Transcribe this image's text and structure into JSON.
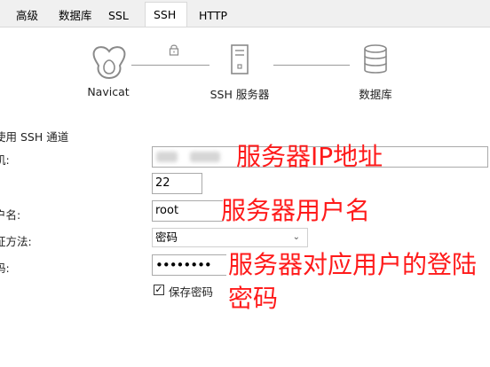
{
  "tabs": [
    {
      "label": "高级"
    },
    {
      "label": "数据库"
    },
    {
      "label": "SSL"
    },
    {
      "label": "SSH",
      "active": true
    },
    {
      "label": "HTTP"
    }
  ],
  "diagram": {
    "client_label": "Navicat",
    "ssh_label": "SSH 服务器",
    "db_label": "数据库"
  },
  "form": {
    "use_ssh_label": "使用 SSH 通道",
    "host_label_suffix": "机:",
    "port_label_suffix": ":",
    "user_label_suffix": "户名:",
    "auth_label_suffix": "证方法:",
    "password_label_suffix": "码:",
    "host_value": "",
    "port_value": "22",
    "user_value": "root",
    "auth_value": "密码",
    "password_value": "••••••••",
    "save_password_label": "保存密码",
    "save_password_checked": true
  },
  "annotations": {
    "host": "服务器IP地址",
    "user": "服务器用户名",
    "password_line1": "服务器对应用户的登陆",
    "password_line2": "密码"
  },
  "colors": {
    "annotation": "#ff1a1a",
    "tab_bg": "#f0f0f0"
  }
}
